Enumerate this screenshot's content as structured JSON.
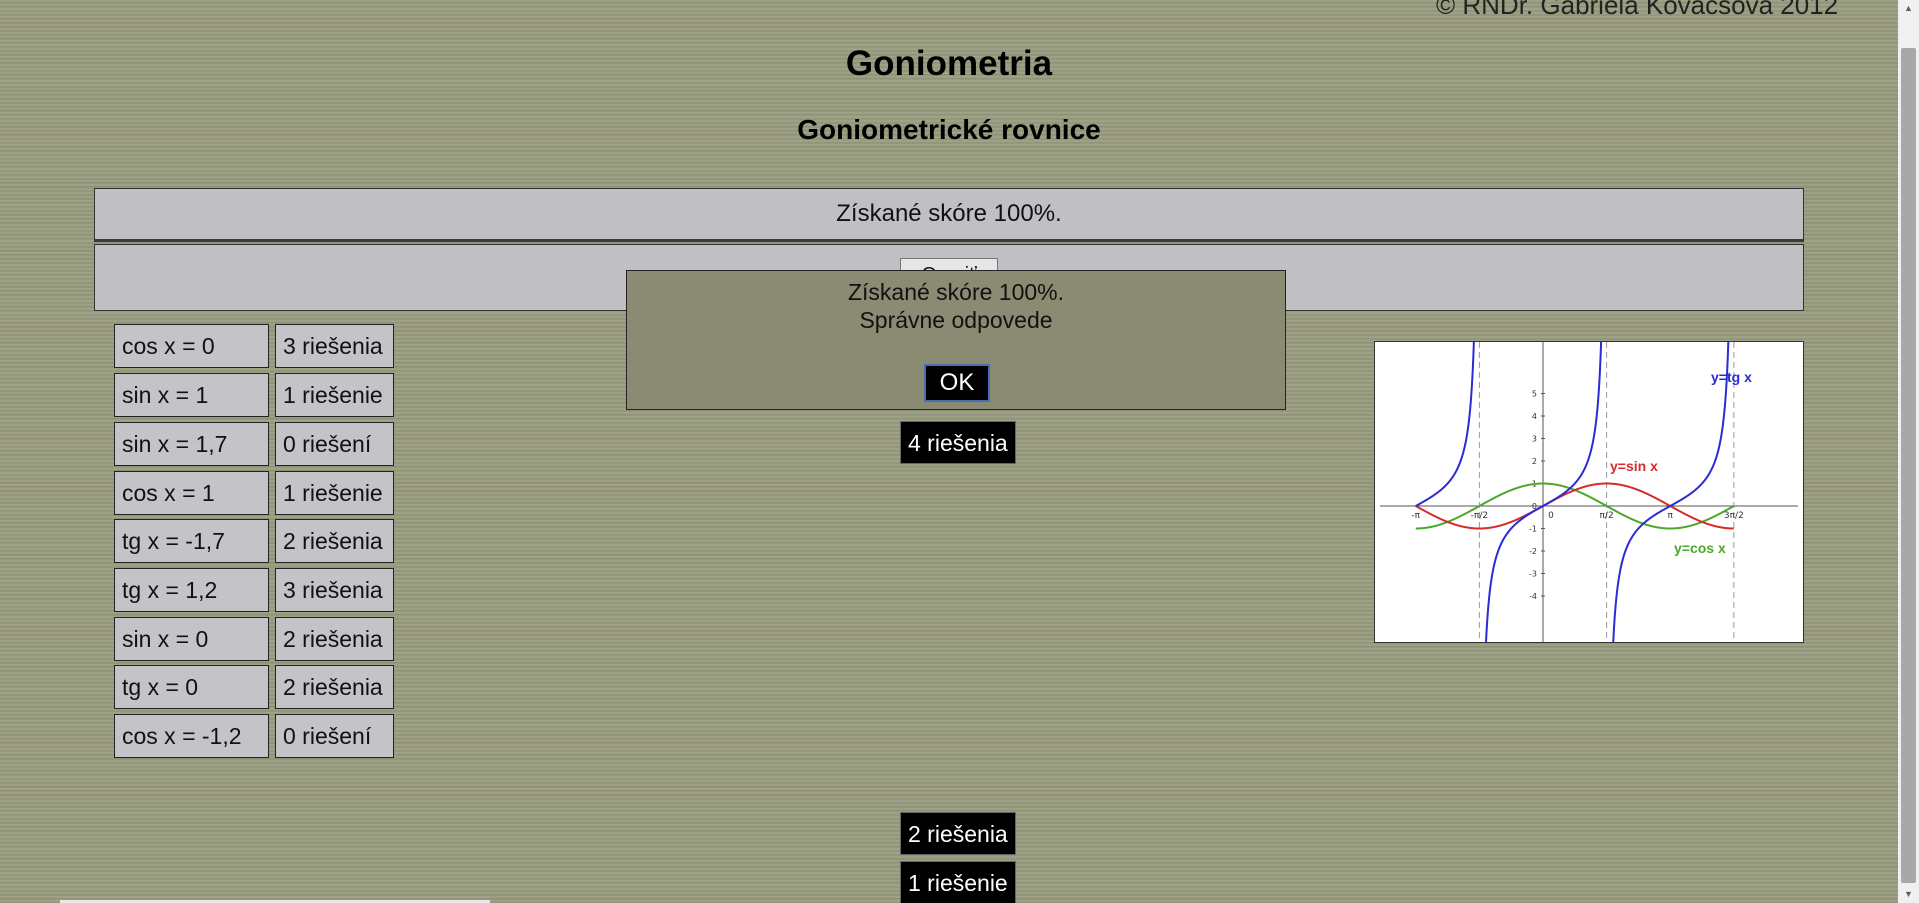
{
  "header": {
    "copyright": "© RNDr. Gabriela Kovácsová 2012",
    "title": "Goniometria",
    "subtitle": "Goniometrické rovnice"
  },
  "score_bar": {
    "text": "Získané skóre 100%."
  },
  "check_button": {
    "label": "Overiť"
  },
  "equations": [
    {
      "eq": "cos x = 0",
      "ans": "3 riešenia"
    },
    {
      "eq": "sin x = 1",
      "ans": "1 riešenie"
    },
    {
      "eq": "sin x = 1,7",
      "ans": "0 riešení"
    },
    {
      "eq": "cos x = 1",
      "ans": "1 riešenie"
    },
    {
      "eq": "tg x = -1,7",
      "ans": "2 riešenia"
    },
    {
      "eq": "tg x = 1,2",
      "ans": "3 riešenia"
    },
    {
      "eq": "sin x = 0",
      "ans": "2 riešenia"
    },
    {
      "eq": "tg x = 0",
      "ans": "2 riešenia"
    },
    {
      "eq": "cos x = -1,2",
      "ans": "0 riešení"
    }
  ],
  "draggables": [
    "4 riešenia",
    "2 riešenia",
    "1 riešenie"
  ],
  "dialog": {
    "line1": "Získané skóre 100%.",
    "line2": "Správne odpovede",
    "ok_label": "OK"
  },
  "graph": {
    "label_tg": "y=tg x",
    "label_sin": "y=sin x",
    "label_cos": "y=cos x",
    "x_ticks": [
      "-π",
      "-π/2",
      "0",
      "π/2",
      "π",
      "3π/2"
    ],
    "y_ticks": [
      "5",
      "4",
      "3",
      "2",
      "1",
      "0",
      "-1",
      "-2",
      "-3",
      "-4"
    ],
    "colors": {
      "tg": "#2b2bd6",
      "sin": "#d62b2b",
      "cos": "#4aa82b"
    }
  }
}
